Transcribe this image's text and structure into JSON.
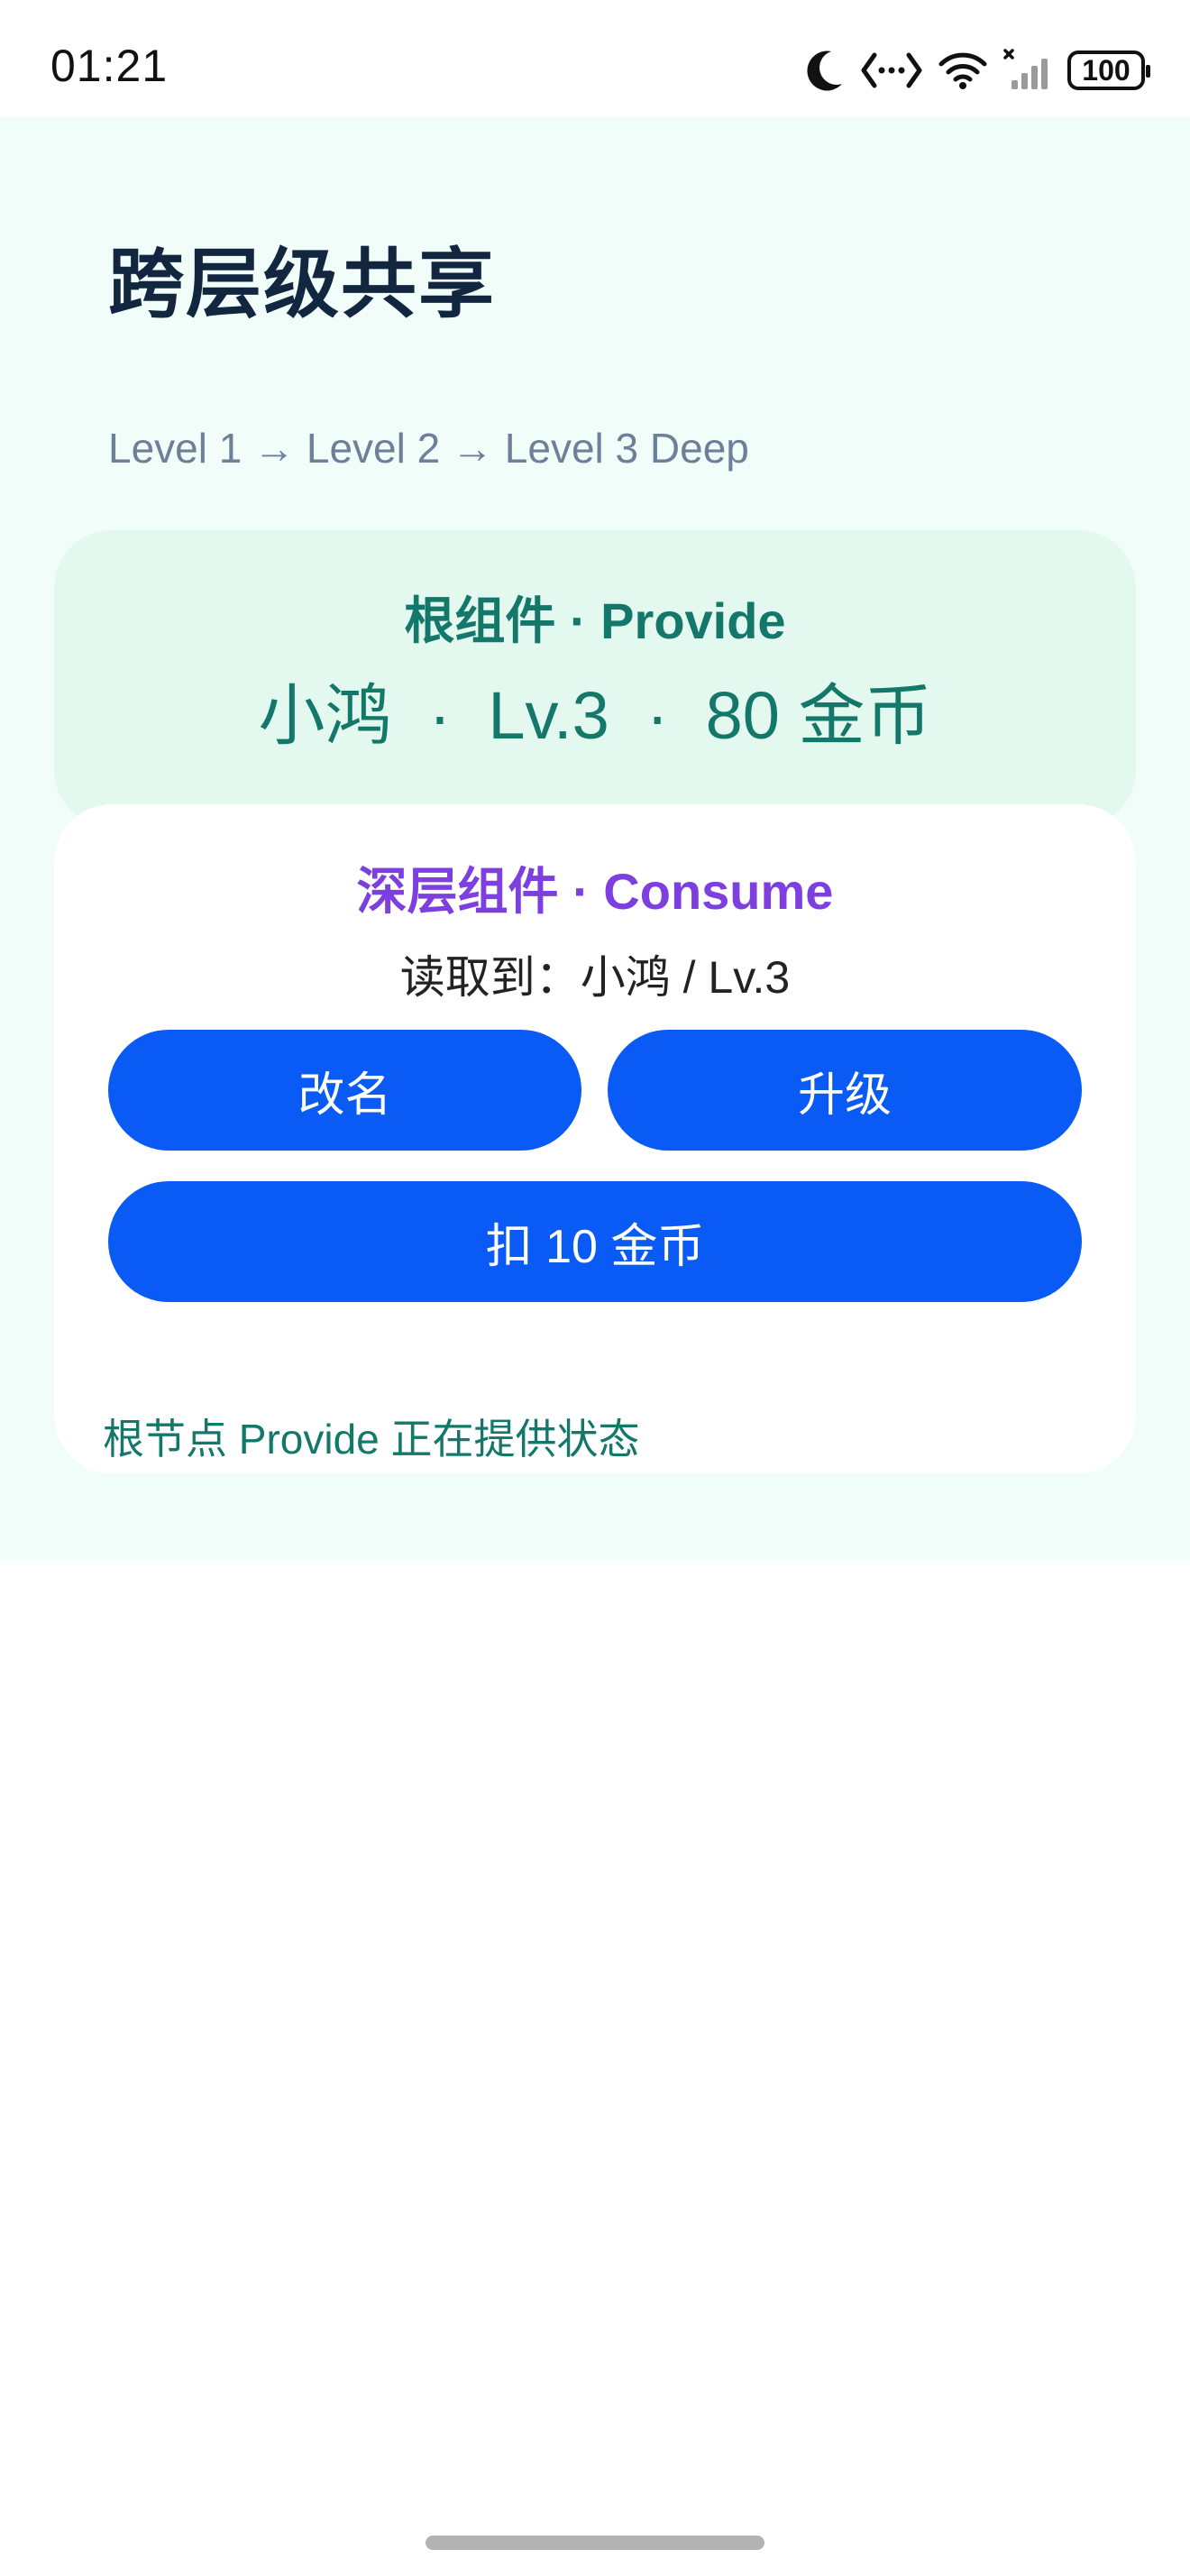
{
  "status_bar": {
    "time": "01:21",
    "icons": [
      "moon-icon",
      "data-transfer-icon",
      "wifi-icon",
      "cellular-no-signal-icon",
      "battery-icon"
    ],
    "battery_level": "100"
  },
  "page": {
    "title": "跨层级共享",
    "breadcrumb": "Level 1 → Level 2 → Level 3 Deep",
    "background": "#f0fdf8"
  },
  "provider": {
    "heading": "根组件 · Provide",
    "stats": "小鸿  ·  Lv.3  ·  80 金币",
    "color": "#13776a",
    "background": "#e3f8ef"
  },
  "consumer": {
    "heading": "深层组件 · Consume",
    "readout": "读取到：小鸿 / Lv.3",
    "heading_color": "#7d3fe0",
    "buttons": {
      "rename": "改名",
      "level_up": "升级",
      "deduct": "扣 10 金币"
    },
    "button_color": "#0a5af5"
  },
  "footer": {
    "status": "根节点 Provide 正在提供状态"
  }
}
